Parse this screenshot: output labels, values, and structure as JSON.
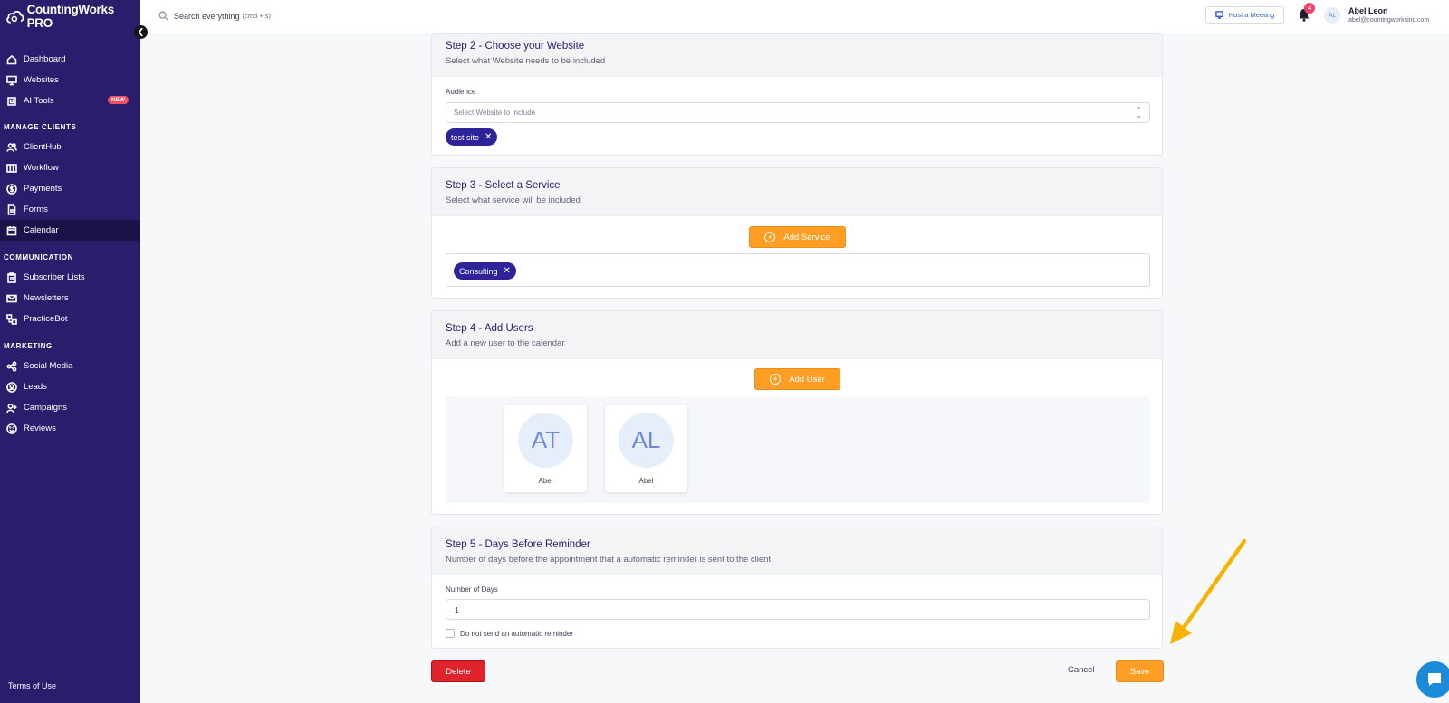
{
  "app": {
    "logo_text": "CountingWorks PRO"
  },
  "sidebar": {
    "main_items": [
      {
        "label": "Dashboard",
        "icon": "home-icon"
      },
      {
        "label": "Websites",
        "icon": "monitor-icon"
      },
      {
        "label": "AI Tools",
        "icon": "chip-icon",
        "badge": "NEW"
      }
    ],
    "sections": [
      {
        "title": "MANAGE CLIENTS",
        "items": [
          {
            "label": "ClientHub",
            "icon": "users-icon"
          },
          {
            "label": "Workflow",
            "icon": "columns-icon"
          },
          {
            "label": "Payments",
            "icon": "dollar-icon"
          },
          {
            "label": "Forms",
            "icon": "file-icon"
          },
          {
            "label": "Calendar",
            "icon": "calendar-icon",
            "active": true
          }
        ]
      },
      {
        "title": "COMMUNICATION",
        "items": [
          {
            "label": "Subscriber Lists",
            "icon": "clipboard-icon"
          },
          {
            "label": "Newsletters",
            "icon": "mail-icon"
          },
          {
            "label": "PracticeBot",
            "icon": "bot-icon"
          }
        ]
      },
      {
        "title": "MARKETING",
        "items": [
          {
            "label": "Social Media",
            "icon": "share-icon"
          },
          {
            "label": "Leads",
            "icon": "user-circle-icon"
          },
          {
            "label": "Campaigns",
            "icon": "user-plus-icon"
          },
          {
            "label": "Reviews",
            "icon": "smile-icon"
          }
        ]
      }
    ],
    "footer_link": "Terms of Use"
  },
  "topbar": {
    "search_placeholder": "Search everything",
    "search_hint": "(cmd + s)",
    "host_meeting_label": "Host a Meeting",
    "notification_count": "4",
    "avatar_initials": "AL",
    "user_name": "Abel Leon",
    "user_email": "abel@countingworksinc.com"
  },
  "step2": {
    "title": "Step 2 - Choose your Website",
    "subtitle": "Select what Website needs to be included",
    "field_label": "Audience",
    "select_placeholder": "Select Website to Include",
    "chip_label": "test site"
  },
  "step3": {
    "title": "Step 3 - Select a Service",
    "subtitle": "Select what service will be included",
    "add_button": "Add Service",
    "chip_label": "Consulting"
  },
  "step4": {
    "title": "Step 4 - Add Users",
    "subtitle": "Add a new user to the calendar",
    "add_button": "Add User",
    "users": [
      {
        "initials": "AT",
        "name": "Abel"
      },
      {
        "initials": "AL",
        "name": "Abel"
      }
    ]
  },
  "step5": {
    "title": "Step 5 - Days Before Reminder",
    "subtitle": "Number of days before the appointment that a automatic reminder is sent to the client.",
    "field_label": "Number of Days",
    "days_value": "1",
    "checkbox_label": "Do not send an automatic reminder"
  },
  "actions": {
    "delete_label": "Delete",
    "cancel_label": "Cancel",
    "save_label": "Save"
  },
  "colors": {
    "sidebar_bg": "#2a1e6c",
    "accent_orange": "#ff9e25",
    "chip_purple": "#2e2399",
    "delete_red": "#e0242c",
    "annotation_arrow": "#f7b300"
  }
}
